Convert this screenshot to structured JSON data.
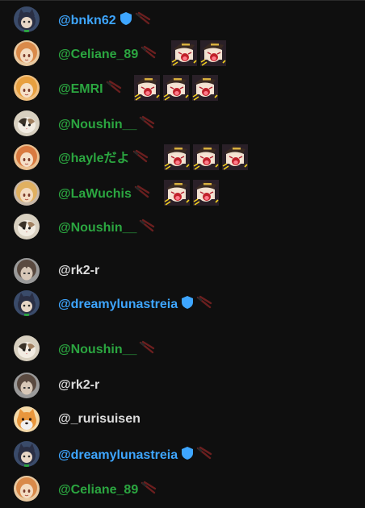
{
  "colors": {
    "background": "#0f0f0f",
    "member": "#2ba640",
    "moderator": "#3ea6ff",
    "viewer": "#dcdcdc",
    "chopsticks": "#6b1f1f"
  },
  "messages": [
    {
      "author": "@bnkn62",
      "role": "moderator",
      "shield": true,
      "emotes": 0,
      "avatar": "black-cat-avatar",
      "avatar_bg": "#3a4b6a",
      "avatar_fg": "#e8d7c6",
      "hair": "#2a2f44"
    },
    {
      "author": "@Celiane_89",
      "role": "member",
      "shield": false,
      "emotes": 2,
      "avatar": "anime-girl-avatar",
      "avatar_bg": "#e9c9a0",
      "avatar_fg": "#f3dcc2",
      "hair": "#d98a4a"
    },
    {
      "author": "@EMRI",
      "role": "member",
      "shield": false,
      "emotes": 3,
      "avatar": "anime-girl-avatar",
      "avatar_bg": "#f0c080",
      "avatar_fg": "#f5e0c8",
      "hair": "#e8a040"
    },
    {
      "author": "@Noushin__",
      "role": "member",
      "shield": false,
      "emotes": 0,
      "avatar": "calico-cat-avatar",
      "avatar_bg": "#d8d0c0",
      "avatar_fg": "#3a3228",
      "hair": "#a08060"
    },
    {
      "author": "@hayleだよ",
      "role": "member",
      "shield": false,
      "emotes": 3,
      "avatar": "anime-girl-avatar",
      "avatar_bg": "#eac090",
      "avatar_fg": "#f5e0c8",
      "hair": "#d97a40"
    },
    {
      "author": "@LaWuchis",
      "role": "member",
      "shield": false,
      "emotes": 2,
      "avatar": "anime-girl-avatar",
      "avatar_bg": "#c8b8a8",
      "avatar_fg": "#f3dcc2",
      "hair": "#e0b060"
    },
    {
      "author": "@Noushin__",
      "role": "member",
      "shield": false,
      "emotes": 0,
      "avatar": "calico-cat-avatar",
      "avatar_bg": "#d8d0c0",
      "avatar_fg": "#3a3228",
      "hair": "#a08060"
    },
    {
      "author": "@rk2-r",
      "role": "viewer",
      "shield": false,
      "emotes": 0,
      "avatar": "anime-boy-avatar",
      "avatar_bg": "#9a9a9a",
      "avatar_fg": "#d8c8b8",
      "hair": "#5a4a40"
    },
    {
      "author": "@dreamylunastreia",
      "role": "moderator",
      "shield": true,
      "emotes": 0,
      "avatar": "black-cat-avatar",
      "avatar_bg": "#3a4b6a",
      "avatar_fg": "#e8d7c6",
      "hair": "#2a2f44"
    },
    {
      "author": "@Noushin__",
      "role": "member",
      "shield": false,
      "emotes": 0,
      "avatar": "calico-cat-avatar",
      "avatar_bg": "#d8d0c0",
      "avatar_fg": "#3a3228",
      "hair": "#a08060"
    },
    {
      "author": "@rk2-r",
      "role": "viewer",
      "shield": false,
      "emotes": 0,
      "avatar": "anime-boy-avatar",
      "avatar_bg": "#9a9a9a",
      "avatar_fg": "#d8c8b8",
      "hair": "#5a4a40"
    },
    {
      "author": "@_rurisuisen",
      "role": "viewer",
      "shield": false,
      "emotes": 0,
      "avatar": "shiba-dog-avatar",
      "avatar_bg": "#f4d9a8",
      "avatar_fg": "#e8963c",
      "hair": "#f0f0f0"
    },
    {
      "author": "@dreamylunastreia",
      "role": "moderator",
      "shield": true,
      "emotes": 0,
      "avatar": "black-cat-avatar",
      "avatar_bg": "#3a4b6a",
      "avatar_fg": "#e8d7c6",
      "hair": "#2a2f44"
    },
    {
      "author": "@Celiane_89",
      "role": "member",
      "shield": false,
      "emotes": 0,
      "avatar": "anime-girl-avatar",
      "avatar_bg": "#e9c9a0",
      "avatar_fg": "#f3dcc2",
      "hair": "#d98a4a"
    }
  ]
}
